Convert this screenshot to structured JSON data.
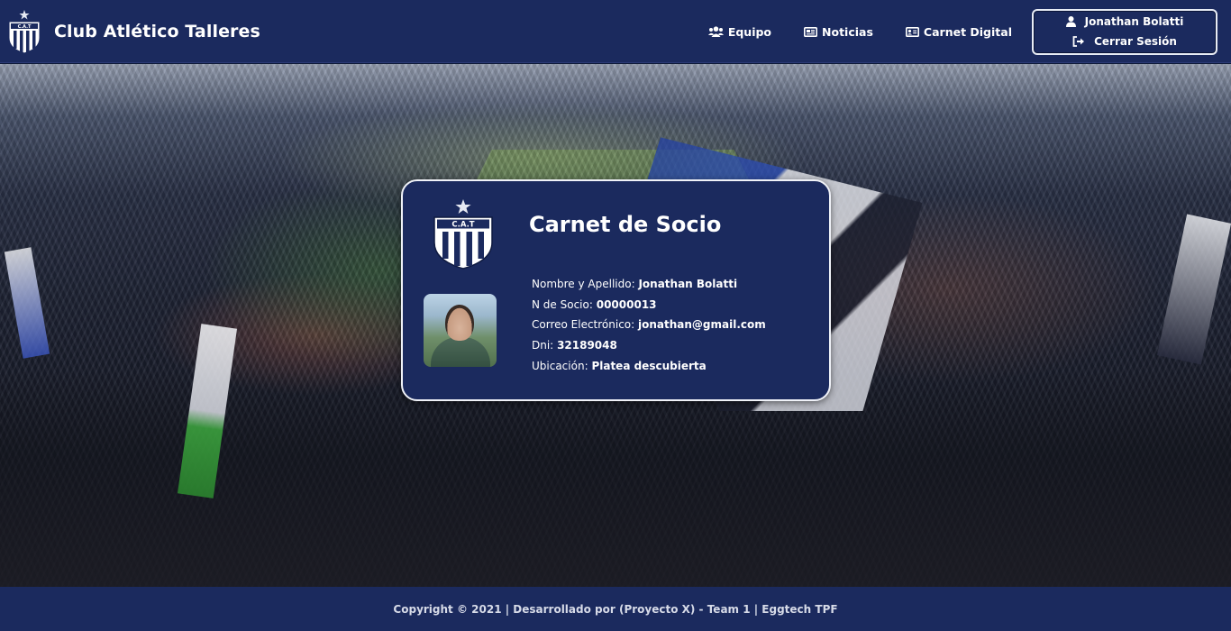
{
  "brand": {
    "name": "Club Atlético Talleres",
    "logo_text": "C.A.T"
  },
  "nav": {
    "items": [
      {
        "label": "Equipo",
        "icon": "users-icon"
      },
      {
        "label": "Noticias",
        "icon": "newspaper-icon"
      },
      {
        "label": "Carnet Digital",
        "icon": "id-card-icon"
      }
    ],
    "user": {
      "name": "Jonathan Bolatti",
      "logout_label": "Cerrar Sesión"
    }
  },
  "card": {
    "title": "Carnet de Socio",
    "logo_text": "C.A.T",
    "fields": [
      {
        "label": "Nombre y Apellido:",
        "value": "Jonathan Bolatti"
      },
      {
        "label": "N de Socio:",
        "value": "00000013"
      },
      {
        "label": "Correo Electrónico:",
        "value": "jonathan@gmail.com"
      },
      {
        "label": "Dni:",
        "value": "32189048"
      },
      {
        "label": "Ubicación:",
        "value": "Platea descubierta"
      }
    ]
  },
  "footer": {
    "text": "Copyright © 2021 | Desarrollado por (Proyecto X) - Team 1 | Eggtech TPF"
  },
  "colors": {
    "navbar": "#1b2a5e",
    "card_bg": "#1b2a5e",
    "accent_white": "#ffffff"
  }
}
